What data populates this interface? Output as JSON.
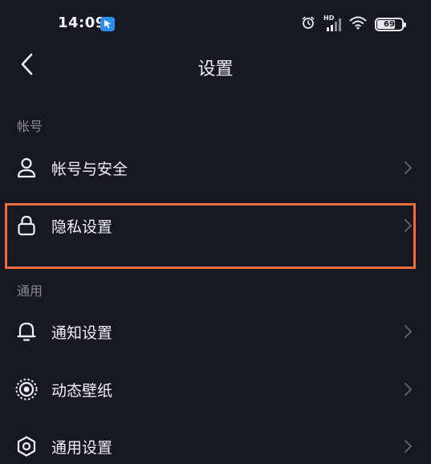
{
  "status_bar": {
    "time": "14:09",
    "battery_level": "69",
    "battery_fraction": 0.69,
    "network_label": "HD",
    "icons": [
      "app-notification-icon",
      "alarm-clock-icon",
      "cellular-signal-icon",
      "wifi-icon",
      "battery-icon"
    ]
  },
  "nav": {
    "title": "设置",
    "back_icon": "back-arrow-icon"
  },
  "sections": [
    {
      "header": "帐号",
      "items": [
        {
          "label": "帐号与安全",
          "icon": "user-icon"
        },
        {
          "label": "隐私设置",
          "icon": "lock-icon"
        }
      ]
    },
    {
      "header": "通用",
      "items": [
        {
          "label": "通知设置",
          "icon": "bell-icon"
        },
        {
          "label": "动态壁纸",
          "icon": "live-wallpaper-icon"
        },
        {
          "label": "通用设置",
          "icon": "gear-icon"
        }
      ]
    }
  ],
  "colors": {
    "background": "#161823",
    "text": "#f0f0f4",
    "section_header": "#8a8b93",
    "chevron": "#5d5e66",
    "highlight_box": "#f06b3b"
  }
}
